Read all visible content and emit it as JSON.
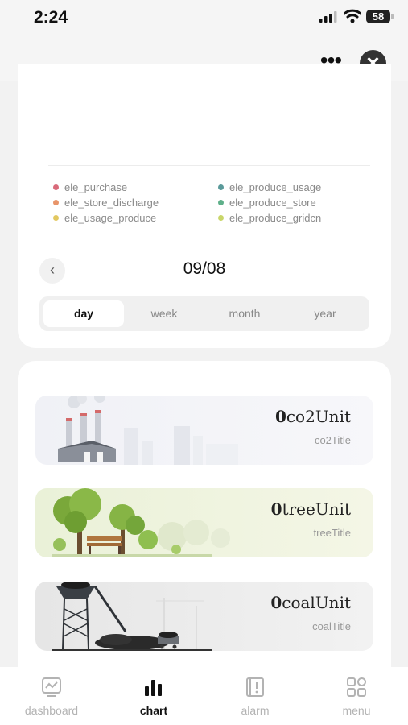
{
  "status_bar": {
    "time": "2:24",
    "battery": "58"
  },
  "legend": [
    {
      "label": "ele_purchase",
      "color": "#d96a7a"
    },
    {
      "label": "ele_produce_usage",
      "color": "#5a9a9a"
    },
    {
      "label": "ele_store_discharge",
      "color": "#e8956a"
    },
    {
      "label": "ele_produce_store",
      "color": "#5fb08a"
    },
    {
      "label": "ele_usage_produce",
      "color": "#e2c860"
    },
    {
      "label": "ele_produce_gridcn",
      "color": "#c9d66a"
    }
  ],
  "date_nav": {
    "date": "09/08",
    "prev_icon": "chevron-left-icon"
  },
  "period_tabs": [
    {
      "label": "day",
      "active": true
    },
    {
      "label": "week",
      "active": false
    },
    {
      "label": "month",
      "active": false
    },
    {
      "label": "year",
      "active": false
    }
  ],
  "impact_cards": [
    {
      "value": "0",
      "unit": "co2Unit",
      "title": "co2Title",
      "bg": "#eef0f4"
    },
    {
      "value": "0",
      "unit": "treeUnit",
      "title": "treeTitle",
      "bg": "#eef3dc"
    },
    {
      "value": "0",
      "unit": "coalUnit",
      "title": "coalTitle",
      "bg": "#ececec"
    }
  ],
  "tab_bar": [
    {
      "label": "dashboard",
      "icon": "dashboard-icon",
      "active": false
    },
    {
      "label": "chart",
      "icon": "bar-chart-icon",
      "active": true
    },
    {
      "label": "alarm",
      "icon": "alarm-icon",
      "active": false
    },
    {
      "label": "menu",
      "icon": "menu-grid-icon",
      "active": false
    }
  ]
}
